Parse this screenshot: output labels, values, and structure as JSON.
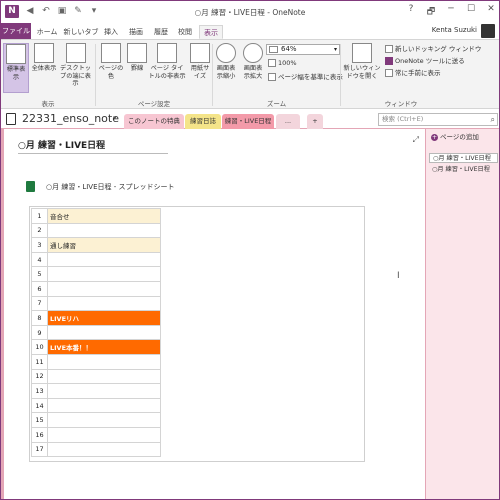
{
  "window": {
    "title": "○月 練習・LIVE日程 - OneNote",
    "app_logo": "N",
    "controls": [
      "?",
      "🗗",
      "─",
      "☐",
      "✕"
    ]
  },
  "qat": [
    "◀",
    "↶",
    "▣",
    "✎",
    "▾"
  ],
  "ribbon_tabs": [
    "ファイル",
    "ホーム",
    "新しいタブ",
    "挿入",
    "描画",
    "履歴",
    "校閲",
    "表示"
  ],
  "user": "Kenta Suzuki",
  "ribbon": {
    "view": {
      "normal": "標準表示",
      "full": "全体表示",
      "dock": "デスクトップの端に表示",
      "group": "表示"
    },
    "page_setup": {
      "page_color": "ページの色",
      "rule_lines": "罫線",
      "hide_title": "ページ タイトルの非表示",
      "paper_size": "用紙サイズ",
      "group": "ページ設定"
    },
    "zoom": {
      "zoom_out": "画面表示縮小",
      "zoom_in": "画面表示拡大",
      "value": "64%",
      "hundred": "100%",
      "page_width": "ページ幅を基準に表示",
      "group": "ズーム"
    },
    "window": {
      "new_window": "新しいウィンドウを開く",
      "new_docked": "新しいドッキング ウィンドウ",
      "send_tools": "OneNote ツールに送る",
      "always_top": "常に手前に表示",
      "group": "ウィンドウ"
    }
  },
  "notebook": {
    "name": "22331_enso_note",
    "sections": [
      {
        "label": "このノートの特典",
        "color": "#f7c6d2"
      },
      {
        "label": "練習日誌",
        "color": "#f4e489"
      },
      {
        "label": "練習・LIVE日程",
        "color": "#f39aa9"
      },
      {
        "label": "...",
        "color": "#f3d5dc"
      },
      {
        "label": "+",
        "color": "#f3d5dc"
      }
    ],
    "search_placeholder": "検索 (Ctrl+E)"
  },
  "page": {
    "title": "○月 練習・LIVE日程",
    "embed_label": "○月 練習・LIVE日程 - スプレッドシート",
    "expand_icon": "⤢",
    "cursor": "I"
  },
  "sheet": {
    "rows": [
      {
        "n": "1",
        "text": "音合せ",
        "style": "cream"
      },
      {
        "n": "2",
        "text": "",
        "style": ""
      },
      {
        "n": "3",
        "text": "通し練習",
        "style": "cream"
      },
      {
        "n": "4",
        "text": "",
        "style": ""
      },
      {
        "n": "5",
        "text": "",
        "style": ""
      },
      {
        "n": "6",
        "text": "",
        "style": ""
      },
      {
        "n": "7",
        "text": "",
        "style": ""
      },
      {
        "n": "8",
        "text": "LIVEリハ",
        "style": "orange"
      },
      {
        "n": "9",
        "text": "",
        "style": ""
      },
      {
        "n": "10",
        "text": "LIVE本番！！",
        "style": "orange"
      },
      {
        "n": "11",
        "text": "",
        "style": ""
      },
      {
        "n": "12",
        "text": "",
        "style": ""
      },
      {
        "n": "13",
        "text": "",
        "style": ""
      },
      {
        "n": "14",
        "text": "",
        "style": ""
      },
      {
        "n": "15",
        "text": "",
        "style": ""
      },
      {
        "n": "16",
        "text": "",
        "style": ""
      },
      {
        "n": "17",
        "text": "",
        "style": ""
      }
    ]
  },
  "pages_pane": {
    "add_page": "ページの追加",
    "pages": [
      "○月 練習・LIVE日程",
      "○月 練習・LIVE日程"
    ]
  }
}
